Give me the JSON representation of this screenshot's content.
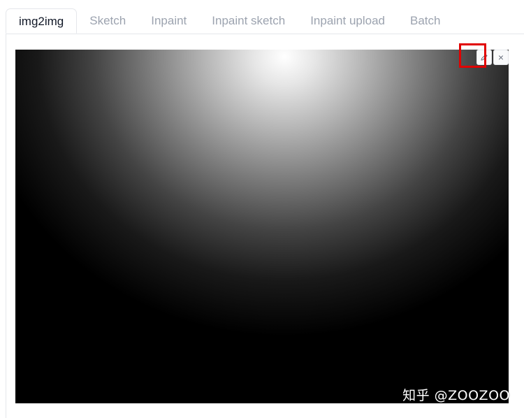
{
  "tabs": [
    {
      "label": "img2img",
      "active": true
    },
    {
      "label": "Sketch",
      "active": false
    },
    {
      "label": "Inpaint",
      "active": false
    },
    {
      "label": "Inpaint sketch",
      "active": false
    },
    {
      "label": "Inpaint upload",
      "active": false
    },
    {
      "label": "Batch",
      "active": false
    }
  ],
  "image_toolbar": {
    "edit_icon": "pencil-icon",
    "close_icon": "close-icon",
    "close_glyph": "×"
  },
  "watermark": {
    "text": "知乎 @ZOOZOO"
  },
  "colors": {
    "highlight": "#e10000",
    "active_tab_text": "#111827",
    "inactive_tab_text": "#9ca3af"
  }
}
